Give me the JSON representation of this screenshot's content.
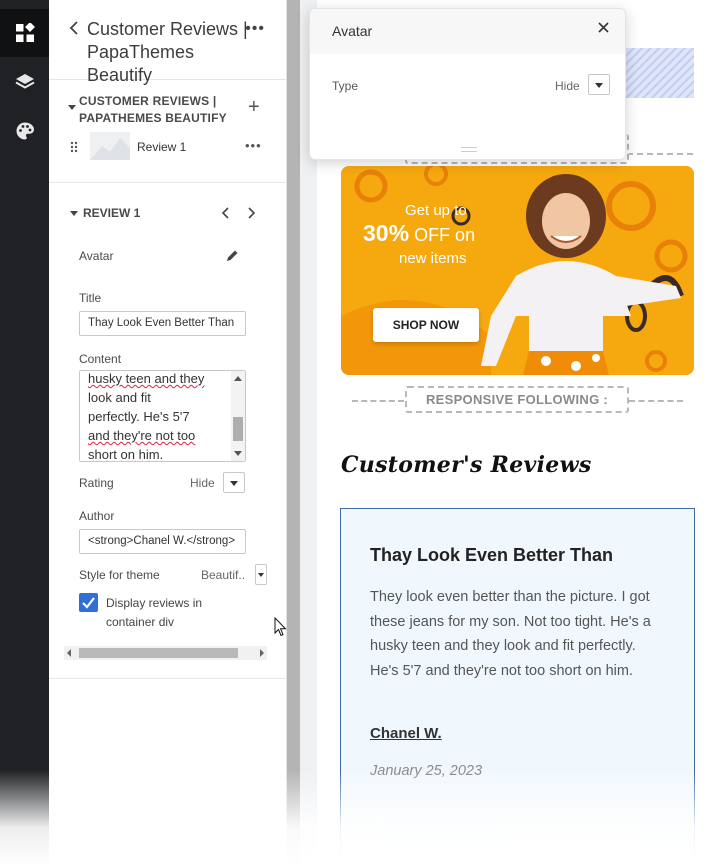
{
  "rail": {
    "icons": [
      "blocks-icon",
      "layers-icon",
      "palette-icon"
    ]
  },
  "panel": {
    "title": "Customer Reviews | PapaThemes Beautify",
    "section": {
      "title": "CUSTOMER REVIEWS | PAPATHEMES BEAUTIFY",
      "items": [
        {
          "label": "Review 1"
        }
      ]
    },
    "review": {
      "title": "REVIEW 1",
      "avatar_label": "Avatar",
      "title_label": "Title",
      "title_value": "Thay Look Even Better Than",
      "content_label": "Content",
      "content_lines": [
        "husky teen and they",
        "look and fit",
        "perfectly. He's 5'7",
        "and they're not too",
        "short on him."
      ],
      "rating_label": "Rating",
      "rating_value": "Hide",
      "author_label": "Author",
      "author_value": "<strong>Chanel W.</strong>",
      "style_label": "Style for theme",
      "style_value": "Beautif..",
      "display_label": "Display reviews in container div",
      "display_checked": true
    }
  },
  "popover": {
    "title": "Avatar",
    "type_label": "Type",
    "type_value": "Hide"
  },
  "canvas": {
    "divider_top": "",
    "banner": {
      "line1": "Get up to",
      "line2_bold": "30%",
      "line2_rest": "OFF on",
      "line3": "new items",
      "button": "SHOP NOW"
    },
    "divider_label": "RESPONSIVE FOLLOWING :",
    "reviews_heading": "Customer's Reviews",
    "review_card": {
      "title": "Thay Look Even Better Than",
      "body": "They look even better than the picture. I got these jeans for my son. Not too tight. He's a husky teen and they look and fit perfectly. He's 5'7 and they're not too short on him.",
      "author": "Chanel W.",
      "date": "January 25, 2023"
    }
  },
  "colors": {
    "rail_bg": "#1f2124",
    "accent": "#2f6fd6",
    "banner": "#f6a90f",
    "card_border": "#3e6aa8",
    "card_bg": "#f1f8fd"
  }
}
